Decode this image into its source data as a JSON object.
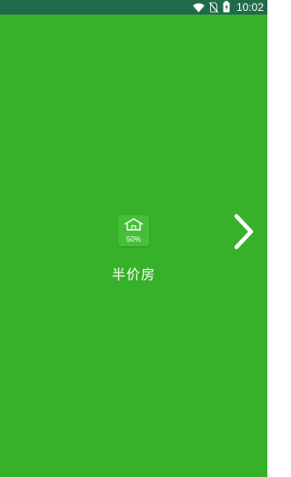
{
  "status_bar": {
    "time": "10:02",
    "icons": [
      "wifi-icon",
      "no-sim-icon",
      "battery-charging-icon"
    ]
  },
  "splash": {
    "logo_text": "50%",
    "logo_icon": "house-icon",
    "title": "半价房"
  },
  "navigation": {
    "next_icon": "chevron-right-icon"
  },
  "colors": {
    "background": "#37b12a",
    "status_bar": "#1f6b4a",
    "logo_tile": "#46bf37",
    "text": "#ffffff"
  }
}
